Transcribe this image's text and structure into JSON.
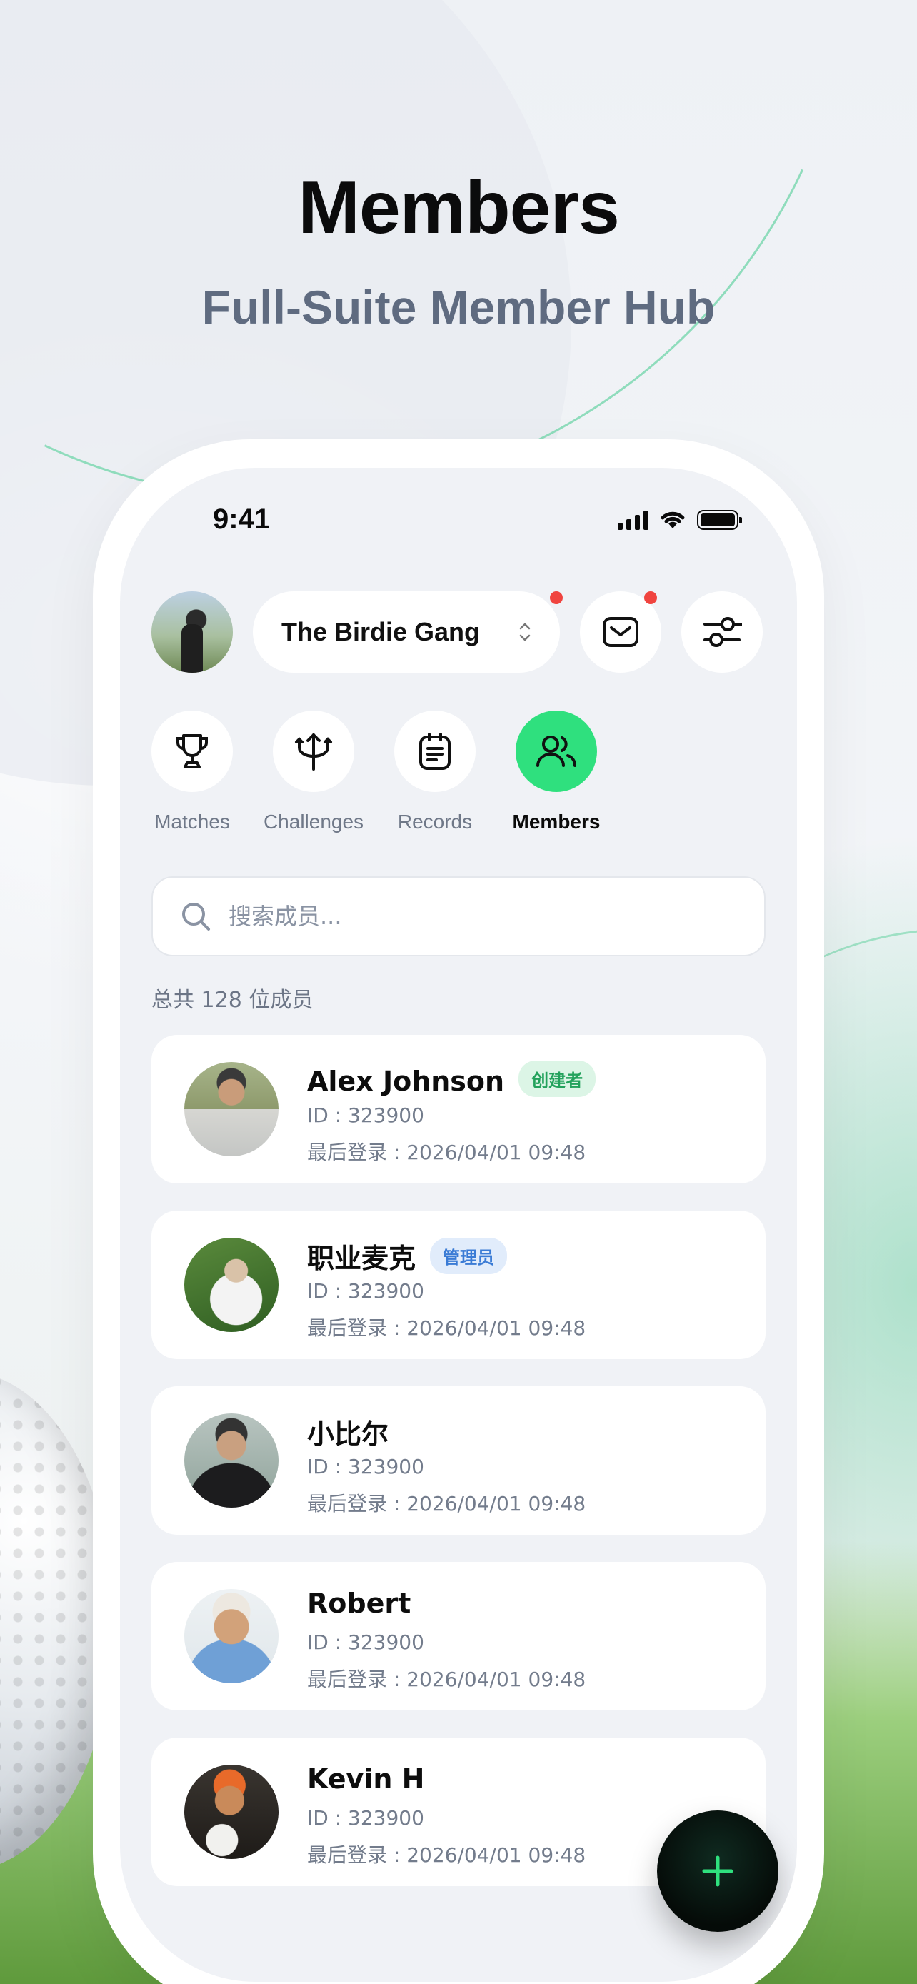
{
  "hero": {
    "title": "Members",
    "subtitle": "Full-Suite Member Hub"
  },
  "status_bar": {
    "time": "9:41"
  },
  "header": {
    "group_name": "The Birdie Gang",
    "icons": [
      "avatar",
      "chevron-updown-icon",
      "mail-icon",
      "sliders-icon"
    ]
  },
  "tabs": [
    {
      "label": "Matches",
      "icon": "trophy-icon",
      "active": false
    },
    {
      "label": "Challenges",
      "icon": "trident-icon",
      "active": false
    },
    {
      "label": "Records",
      "icon": "clipboard-icon",
      "active": false
    },
    {
      "label": "Members",
      "icon": "users-icon",
      "active": true
    }
  ],
  "search": {
    "placeholder": "搜索成员..."
  },
  "member_count": "总共 128 位成员",
  "members": [
    {
      "name": "Alex Johnson",
      "badge": "创建者",
      "id": "ID : 323900",
      "last_login": "最后登录 : 2026/04/01 09:48"
    },
    {
      "name": "职业麦克",
      "badge": "管理员",
      "id": "ID : 323900",
      "last_login": "最后登录 : 2026/04/01 09:48"
    },
    {
      "name": "小比尔",
      "badge": "",
      "id": "ID : 323900",
      "last_login": "最后登录 : 2026/04/01 09:48"
    },
    {
      "name": "Robert",
      "badge": "",
      "id": "ID : 323900",
      "last_login": "最后登录 : 2026/04/01 09:48"
    },
    {
      "name": "Kevin H",
      "badge": "",
      "id": "ID : 323900",
      "last_login": "最后登录 : 2026/04/01 09:48"
    }
  ],
  "colors": {
    "accent_green": "#2fe07e",
    "notification_red": "#f0443f",
    "creator_badge": "#23a25c",
    "admin_badge": "#3a7bd5"
  }
}
